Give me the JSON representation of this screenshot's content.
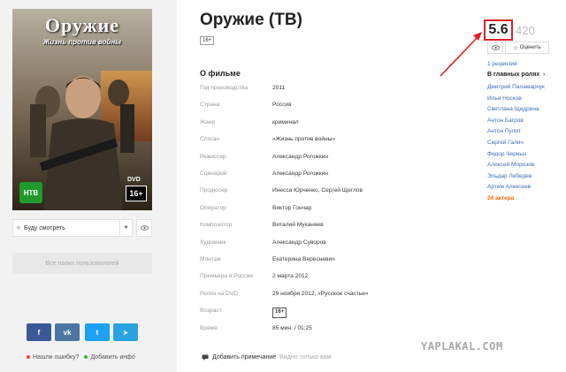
{
  "film": {
    "title": "Оружие (ТВ)",
    "age_badge": "16+",
    "section_title": "О фильме"
  },
  "poster": {
    "title_line1": "Оружие",
    "tagline": "Жизнь против войны",
    "channel_logo": "НТВ",
    "dvd_label": "DVD",
    "age": "16+"
  },
  "left": {
    "watch_label": "Буду смотреть",
    "folders_label": "Все папки пользователей",
    "error_link": "Нашли ошибку?",
    "add_info_link": "Добавить инфо"
  },
  "social": {
    "fb": "f",
    "vk": "vk",
    "tw": "t",
    "tg": "➤"
  },
  "info": [
    {
      "key": "Год производства",
      "value": "2011"
    },
    {
      "key": "Страна",
      "value": "Россия"
    },
    {
      "key": "Жанр",
      "value": "криминал"
    },
    {
      "key": "Слоган",
      "value": "«Жизнь против войны»"
    },
    {
      "key": "Режиссер",
      "value": "Александр Рогожкин"
    },
    {
      "key": "Сценарий",
      "value": "Александр Рогожкин"
    },
    {
      "key": "Продюсер",
      "value": "Инесса Юрченко, Сергей Щеглов"
    },
    {
      "key": "Оператор",
      "value": "Виктор Гончар"
    },
    {
      "key": "Композитор",
      "value": "Виталий Муканяев"
    },
    {
      "key": "Художник",
      "value": "Александр Суворов"
    },
    {
      "key": "Монтаж",
      "value": "Екатерина Вересневич"
    },
    {
      "key": "Премьера в России",
      "value": "2 марта 2012"
    },
    {
      "key": "Релиз на DVD",
      "value": "29 ноября 2012, «Русское счастье»"
    },
    {
      "key": "Возраст",
      "value": "16+"
    },
    {
      "key": "Время",
      "value": "85 мин. / 01:25"
    }
  ],
  "note": {
    "label": "Добавить примечание",
    "hint": "Видно только вам"
  },
  "rating": {
    "value": "5.6",
    "votes": "420",
    "rate_label": "Оценить",
    "reviews": "1 рецензия"
  },
  "cast": {
    "title": "В главных ролях",
    "actors": [
      "Дмитрий Паламарчук",
      "Илья Носков",
      "Светлана Щедрина",
      "Антон Багров",
      "Антон Пулит",
      "Сергей Галич",
      "Федор Черных",
      "Алексей Морозов",
      "Эльдар Лебедев",
      "Артем Алексеев"
    ],
    "count_label": "24 актера"
  },
  "watermark": "YAPLAKAL.COM"
}
